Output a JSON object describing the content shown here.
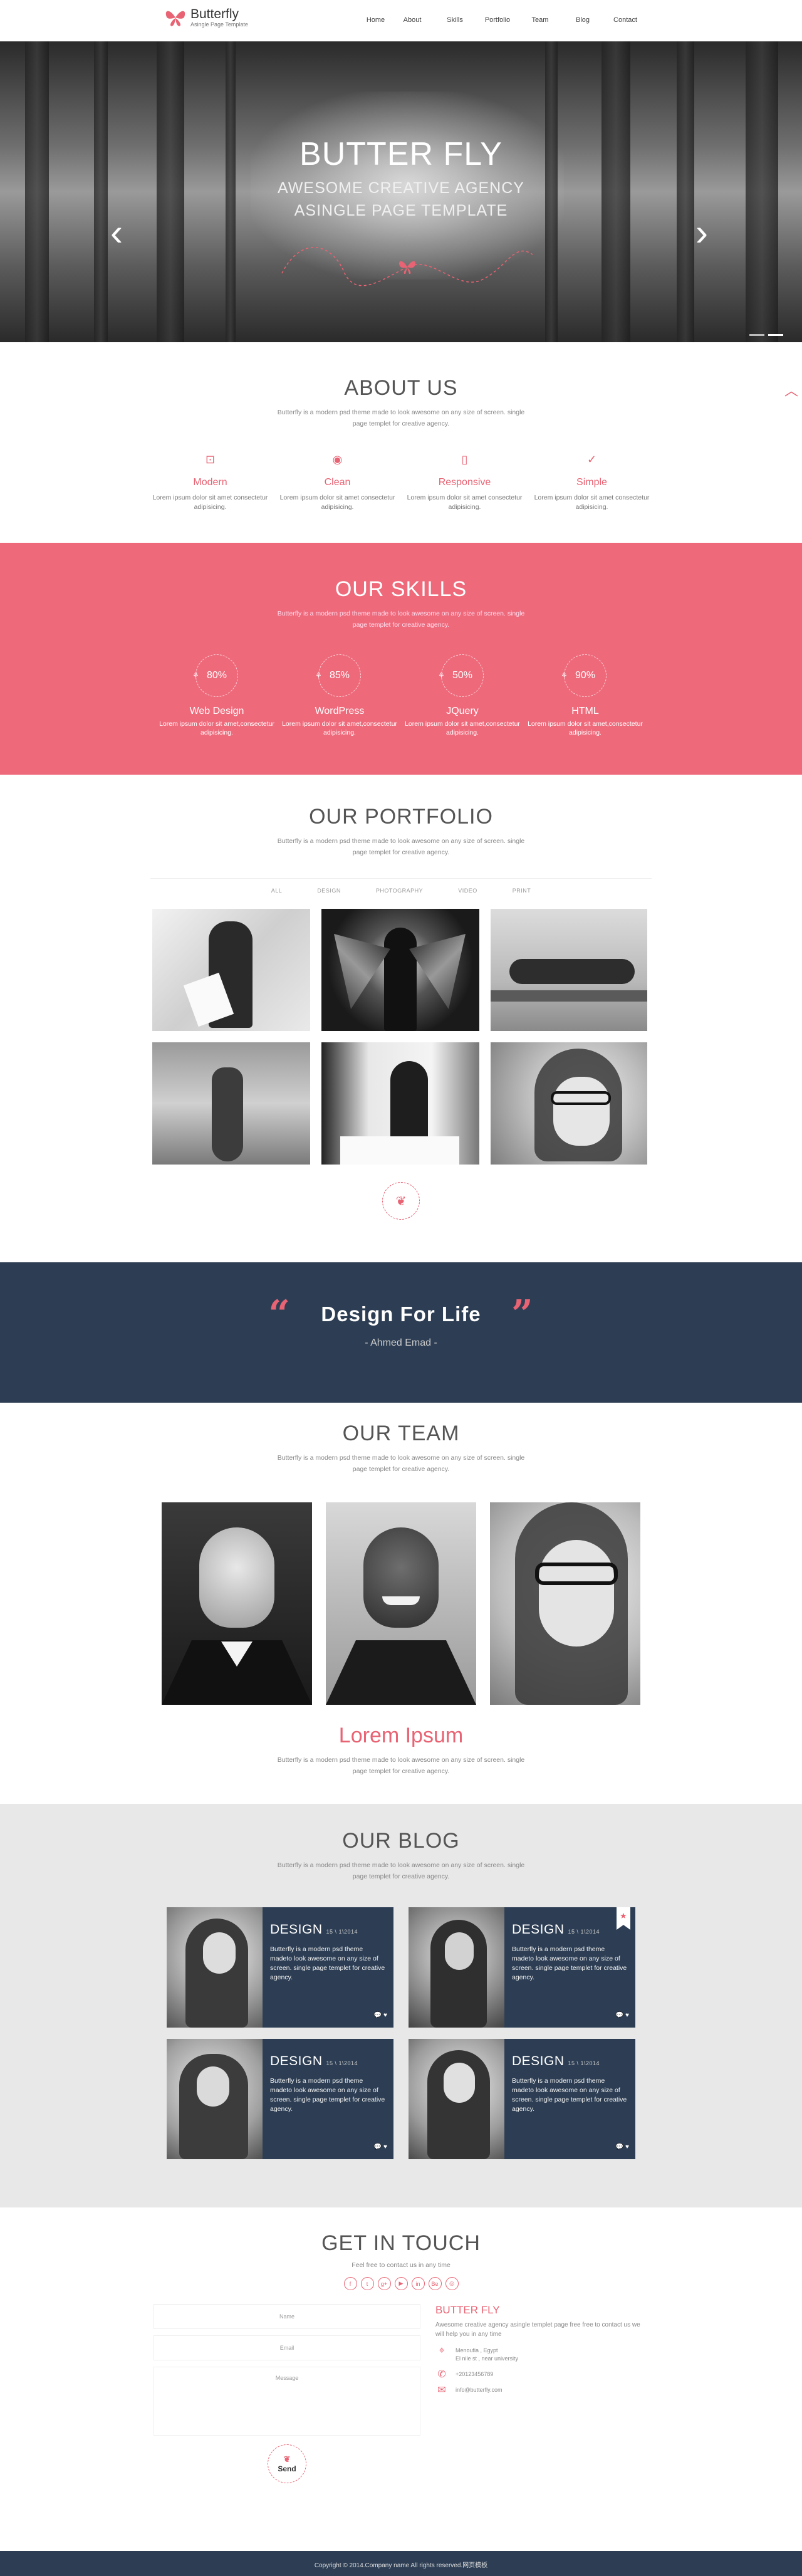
{
  "brand": {
    "name": "Butterfly",
    "tagline": "Asingle Page Template"
  },
  "nav": {
    "items": [
      "Home",
      "About",
      "Skills",
      "Portfolio",
      "Team",
      "Blog",
      "Contact"
    ]
  },
  "hero": {
    "title": "BUTTER FLY",
    "line1": "AWESOME CREATIVE AGENCY",
    "line2": "ASINGLE PAGE TEMPLATE",
    "prev": "‹",
    "next": "›"
  },
  "about": {
    "title": "ABOUT US",
    "subtitle": "Butterfly is a modern psd theme made to look awesome on any size of screen. single page templet for creative agency.",
    "features": [
      {
        "icon": "briefcase-icon",
        "glyph": "⊡",
        "title": "Modern",
        "text": "Lorem ipsum dolor sit amet consectetur adipisicing."
      },
      {
        "icon": "eye-icon",
        "glyph": "◉",
        "title": "Clean",
        "text": "Lorem ipsum dolor sit amet consectetur adipisicing."
      },
      {
        "icon": "mobile-icon",
        "glyph": "▯",
        "title": "Responsive",
        "text": "Lorem ipsum dolor sit amet consectetur adipisicing."
      },
      {
        "icon": "check-icon",
        "glyph": "✓",
        "title": "Simple",
        "text": "Lorem ipsum dolor sit amet consectetur adipisicing."
      }
    ]
  },
  "skills": {
    "title": "OUR SKILLS",
    "subtitle": "Butterfly is a modern psd theme made to look awesome on any size of screen. single page templet for creative agency.",
    "items": [
      {
        "value": "80%",
        "name": "Web Design",
        "text": "Lorem ipsum dolor sit amet,consectetur adipisicing."
      },
      {
        "value": "85%",
        "name": "WordPress",
        "text": "Lorem ipsum dolor sit amet,consectetur adipisicing."
      },
      {
        "value": "50%",
        "name": "JQuery",
        "text": "Lorem ipsum dolor sit amet,consectetur adipisicing."
      },
      {
        "value": "90%",
        "name": "HTML",
        "text": "Lorem ipsum dolor sit amet,consectetur adipisicing."
      }
    ]
  },
  "portfolio": {
    "title": "OUR PORTFOLIO",
    "subtitle": "Butterfly is a modern psd theme made to look awesome on any size of screen. single page templet for creative agency.",
    "filters": [
      "ALL",
      "DESIGN",
      "PHOTOGRAPHY",
      "VIDEO",
      "PRINT"
    ]
  },
  "quote": {
    "text": "Design For Life",
    "author": "- Ahmed Emad -"
  },
  "team": {
    "title": "OUR TEAM",
    "subtitle": "Butterfly is a modern psd theme made to look awesome on any size of screen. single page templet for creative agency.",
    "name": "Lorem Ipsum",
    "bio": "Butterfly is a modern psd theme made to look awesome on any size of screen. single page templet for creative agency."
  },
  "blog": {
    "title": "OUR BLOG",
    "subtitle": "Butterfly is a modern psd theme made to look awesome on any size of screen. single page templet for creative agency.",
    "posts": [
      {
        "title": "DESIGN",
        "date": "15 \\ 1\\2014",
        "text": "Butterfly is a modern psd theme madeto look awesome on any size of screen. single page templet for creative agency.",
        "meta": "💬 ♥"
      },
      {
        "title": "DESIGN",
        "date": "15 \\ 1\\2014",
        "text": "Butterfly is a modern psd theme madeto look awesome on any size of screen. single page templet for creative agency.",
        "meta": "💬 ♥"
      },
      {
        "title": "DESIGN",
        "date": "15 \\ 1\\2014",
        "text": "Butterfly is a modern psd theme madeto look awesome on any size of screen. single page templet for creative agency.",
        "meta": "💬 ♥"
      },
      {
        "title": "DESIGN",
        "date": "15 \\ 1\\2014",
        "text": "Butterfly is a modern psd theme madeto look awesome on any size of screen. single page templet for creative agency.",
        "meta": "💬 ♥"
      }
    ]
  },
  "contact": {
    "title": "GET IN TOUCH",
    "subtitle": "Feel free to contact us in any time",
    "social": [
      "f",
      "t",
      "g+",
      "▶",
      "in",
      "Be",
      "◎"
    ],
    "form": {
      "name": "Name",
      "email": "Email",
      "message": "Message",
      "send": "Send"
    },
    "info_title": "BUTTER FLY",
    "info_text": "Awesome creative agency asingle templet page free free to contact us we will help you in any time",
    "address": [
      "Menoufia , Egypt",
      "El nile st , near university"
    ],
    "phone": "+20123456789",
    "email": "info@butterfly.com"
  },
  "footer": {
    "text": "Copyright © 2014.Company name All rights reserved.网页模板"
  },
  "colors": {
    "accent": "#ee6a7b",
    "navy": "#2d3e54"
  }
}
